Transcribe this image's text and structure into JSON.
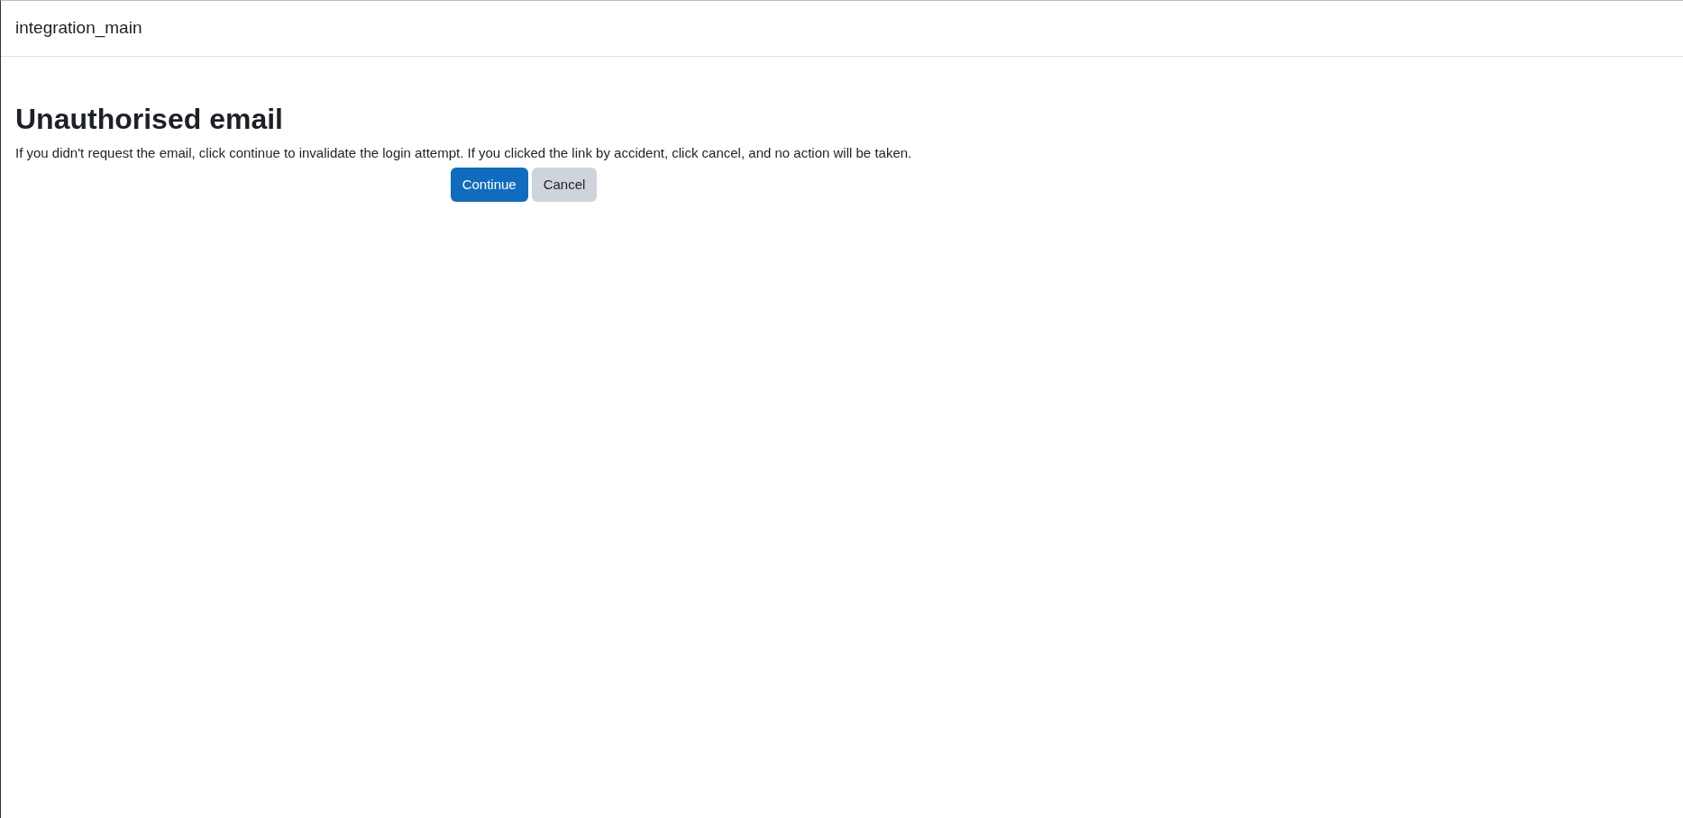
{
  "header": {
    "title": "integration_main"
  },
  "page": {
    "heading": "Unauthorised email",
    "message": "If you didn't request the email, click continue to invalidate the login attempt. If you clicked the link by accident, click cancel, and no action will be taken."
  },
  "buttons": [
    {
      "label": "Continue",
      "kind": "primary"
    },
    {
      "label": "Cancel",
      "kind": "secondary"
    }
  ]
}
